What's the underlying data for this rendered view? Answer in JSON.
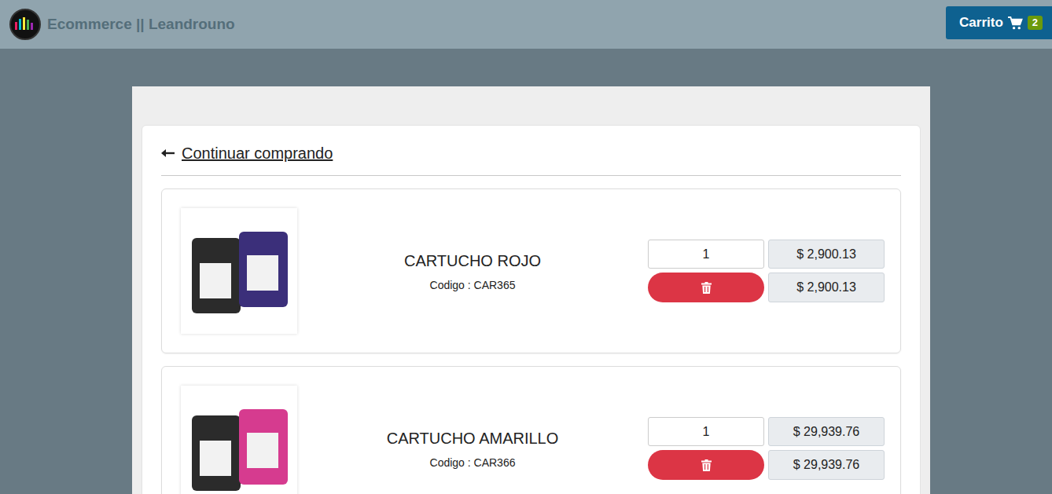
{
  "header": {
    "title": "Ecommerce || Leandrouno",
    "cart_label": "Carrito",
    "cart_count": "2"
  },
  "back_link": "Continuar comprando",
  "items": [
    {
      "name": "CARTUCHO ROJO",
      "code": "Codigo : CAR365",
      "quantity": "1",
      "unit_price": "$ 2,900.13",
      "total": "$ 2,900.13"
    },
    {
      "name": "CARTUCHO AMARILLO",
      "code": "Codigo : CAR366",
      "quantity": "1",
      "unit_price": "$ 29,939.76",
      "total": "$ 29,939.76"
    }
  ]
}
